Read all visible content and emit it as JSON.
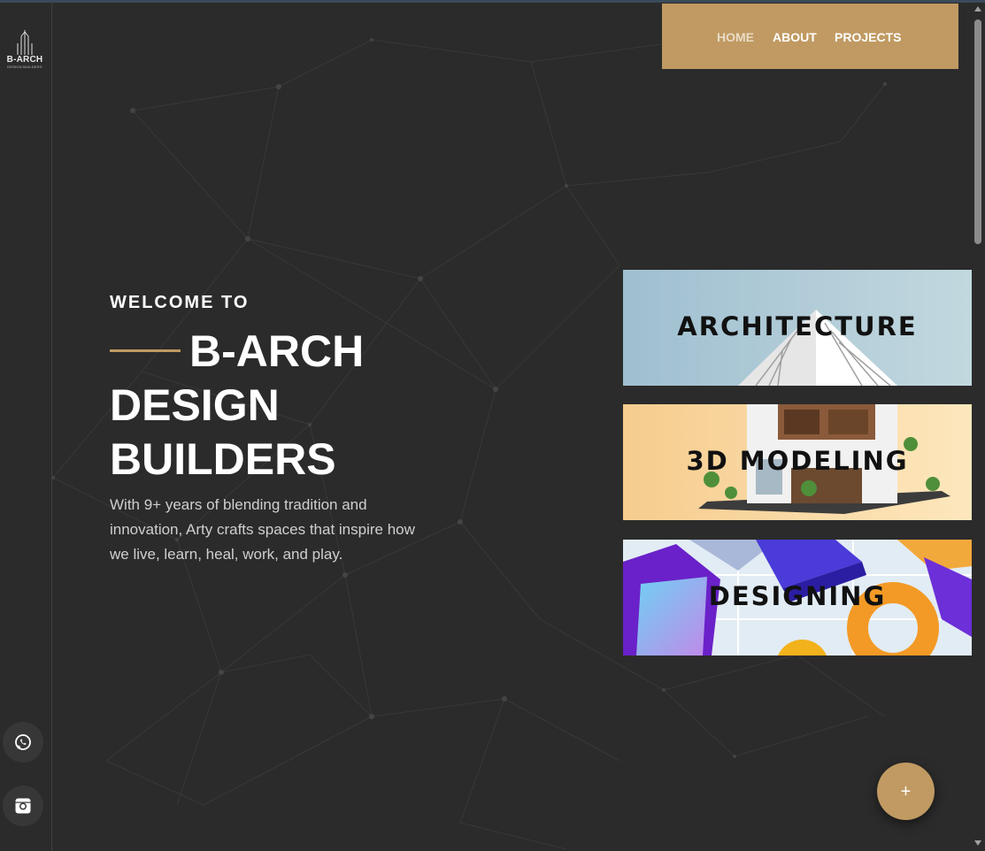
{
  "brand": {
    "name": "B-ARCH",
    "tagline": "DESIGN BUILDERS"
  },
  "nav": {
    "items": [
      {
        "label": "HOME",
        "active": true
      },
      {
        "label": "ABOUT",
        "active": false
      },
      {
        "label": "PROJECTS",
        "active": false
      }
    ]
  },
  "hero": {
    "welcome": "WELCOME TO",
    "title_line1": "B-ARCH",
    "title_line2": "DESIGN",
    "title_line3": "BUILDERS",
    "description": "With 9+ years of blending tradition and innovation, Arty crafts spaces that inspire how we live, learn, heal, work, and play."
  },
  "services": [
    {
      "label": "ARCHITECTURE"
    },
    {
      "label": "3D MODELING"
    },
    {
      "label": "DESIGNING"
    }
  ],
  "social": [
    {
      "icon": "whatsapp-icon"
    },
    {
      "icon": "instagram-icon"
    }
  ],
  "fab": {
    "label": "+"
  },
  "colors": {
    "accent": "#c09a62",
    "background": "#2b2b2b",
    "text": "#ffffff",
    "muted": "#cfcfcf"
  }
}
